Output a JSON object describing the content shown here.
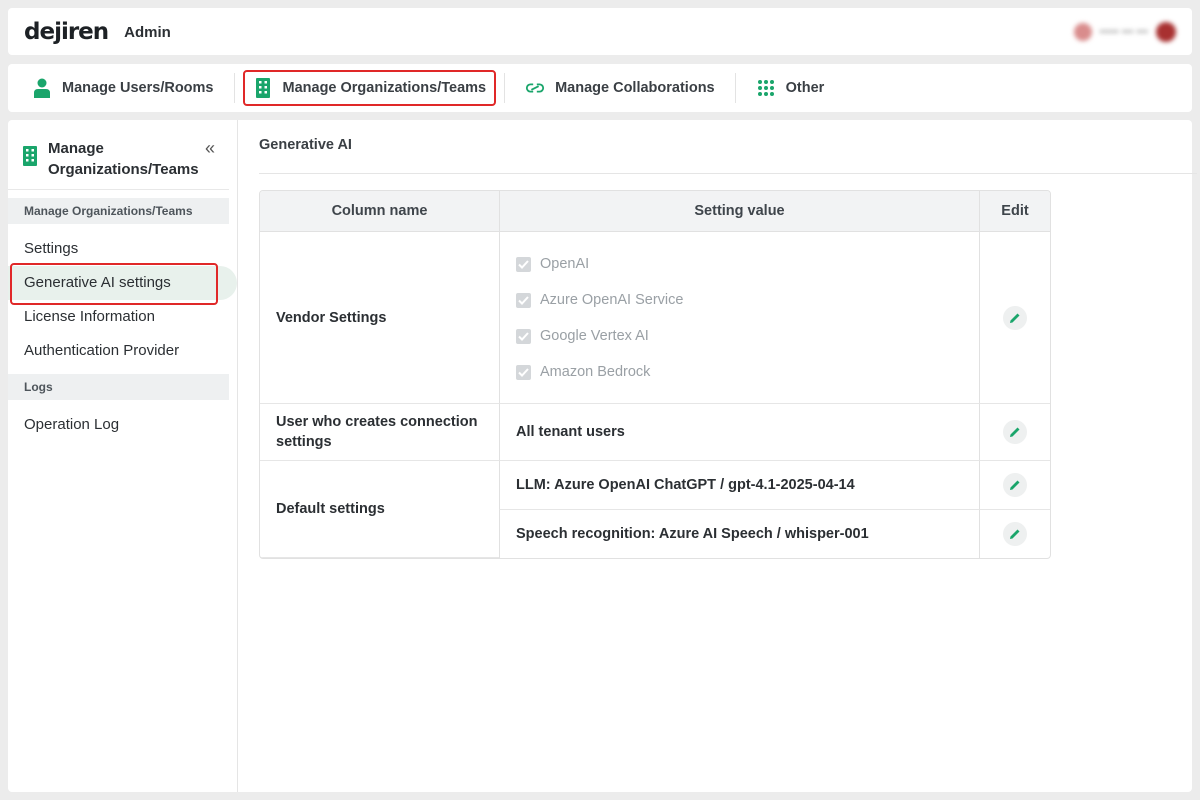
{
  "header": {
    "logo": "dejiren",
    "title": "Admin",
    "user_placeholder": "••••• ••• •••"
  },
  "nav": {
    "items": [
      {
        "label": "Manage Users/Rooms",
        "icon": "user-icon"
      },
      {
        "label": "Manage Organizations/Teams",
        "icon": "building-icon",
        "active": true
      },
      {
        "label": "Manage Collaborations",
        "icon": "link-icon"
      },
      {
        "label": "Other",
        "icon": "grid-dots-icon"
      }
    ]
  },
  "sidebar": {
    "title": "Manage Organizations/Teams",
    "sections": [
      {
        "label": "Manage Organizations/Teams",
        "items": [
          "Settings",
          "Generative AI settings",
          "License Information",
          "Authentication Provider"
        ]
      },
      {
        "label": "Logs",
        "items": [
          "Operation Log"
        ]
      }
    ],
    "active_item": "Generative AI settings"
  },
  "main": {
    "title": "Generative AI",
    "table": {
      "headers": [
        "Column name",
        "Setting value",
        "Edit"
      ],
      "vendor_row": {
        "name": "Vendor Settings",
        "vendors": [
          "OpenAI",
          "Azure OpenAI Service",
          "Google Vertex AI",
          "Amazon Bedrock"
        ]
      },
      "creator_row": {
        "name": "User who creates connection settings",
        "value": "All tenant users"
      },
      "default_row": {
        "name": "Default settings",
        "values": [
          "LLM: Azure OpenAI ChatGPT / gpt-4.1-2025-04-14",
          "Speech recognition: Azure AI Speech / whisper-001"
        ]
      }
    }
  },
  "colors": {
    "accent": "#1aa56b",
    "highlight": "#e02828"
  }
}
